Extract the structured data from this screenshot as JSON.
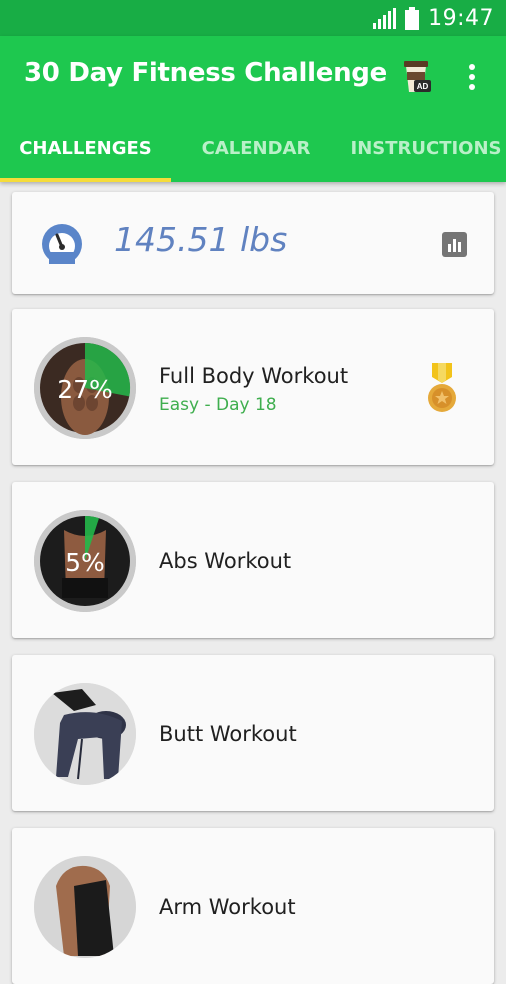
{
  "status_bar": {
    "time": "19:47",
    "icons": [
      "signal-icon",
      "battery-icon"
    ]
  },
  "app_bar": {
    "title": "30 Day Fitness Challenge",
    "icons": [
      "ad-coffee-icon",
      "more-vert-icon"
    ],
    "ad_badge": "AD"
  },
  "tabs": [
    {
      "label": "CHALLENGES",
      "active": true
    },
    {
      "label": "CALENDAR",
      "active": false
    },
    {
      "label": "INSTRUCTIONS",
      "active": false
    }
  ],
  "weight": {
    "value": "145.51 lbs",
    "icons": [
      "speedometer-icon",
      "bar-chart-icon"
    ]
  },
  "workouts": [
    {
      "name": "Full Body Workout",
      "subtitle": "Easy - Day 18",
      "progress_label": "27%",
      "progress": 0.27,
      "medal": true
    },
    {
      "name": "Abs Workout",
      "subtitle": "",
      "progress_label": "5%",
      "progress": 0.05,
      "medal": false
    },
    {
      "name": "Butt Workout",
      "subtitle": "",
      "progress_label": "",
      "progress": null,
      "medal": false
    },
    {
      "name": "Arm Workout",
      "subtitle": "",
      "progress_label": "",
      "progress": null,
      "medal": false
    }
  ],
  "colors": {
    "app_bar": "#1ec84f",
    "status_bar": "#18ad45",
    "tab_indicator": "#f5dc3a",
    "weight_text": "#6082c0",
    "subtitle_green": "#3fae4e",
    "progress_green": "#25b84a"
  }
}
